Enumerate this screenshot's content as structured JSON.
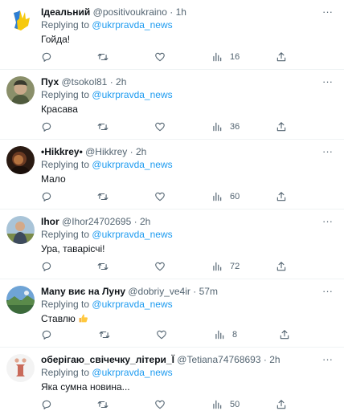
{
  "replying_label": "Replying to",
  "replies": [
    {
      "name": "Ідеальний",
      "handle": "@positivoukraino",
      "time": "1h",
      "mention": "@ukrpravda_news",
      "text": "Гойда!",
      "views": "16",
      "avatar": "flag-hand-avatar"
    },
    {
      "name": "Пух",
      "handle": "@tsokol81",
      "time": "2h",
      "mention": "@ukrpravda_news",
      "text": "Красава",
      "views": "36",
      "avatar": "portrait-avatar"
    },
    {
      "name": "•Hikkrey•",
      "handle": "@Hikkrey",
      "time": "2h",
      "mention": "@ukrpravda_news",
      "text": "Мало",
      "views": "60",
      "avatar": "dark-portrait-avatar"
    },
    {
      "name": "Ihor",
      "handle": "@Ihor24702695",
      "time": "2h",
      "mention": "@ukrpravda_news",
      "text": "Ура, таварісчі!",
      "views": "72",
      "avatar": "outdoor-portrait-avatar"
    },
    {
      "name": "Many виє на Луну",
      "handle": "@dobriy_ve4ir",
      "time": "57m",
      "mention": "@ukrpravda_news",
      "text": "Ставлю",
      "text_emoji": "thumbs-up-emoji",
      "views": "8",
      "avatar": "landscape-avatar"
    },
    {
      "name": "оберігаю_свічечку_літери_Ї",
      "handle": "@Tetiana74768693",
      "time": "2h",
      "mention": "@ukrpravda_news",
      "text": "Яка сумна новина...",
      "views": "50",
      "avatar": "letter-i-avatar"
    }
  ],
  "icons": {
    "more": "more-options-icon",
    "reply": "reply-icon",
    "repost": "repost-icon",
    "like": "like-icon",
    "views": "views-icon",
    "share": "share-icon"
  },
  "colors": {
    "link": "#1d9bf0",
    "secondary": "#536471",
    "text": "#0f1419",
    "divider": "#eff3f4"
  }
}
